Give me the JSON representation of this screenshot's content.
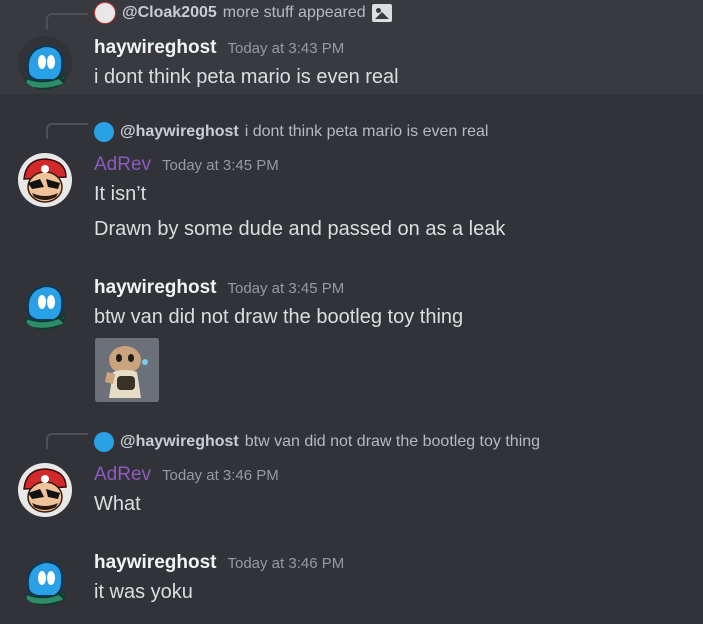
{
  "messages": [
    {
      "reply": {
        "mention": "@Cloak2005",
        "text": "more stuff appeared",
        "icon": "image-icon"
      },
      "author": "haywireghost",
      "timestamp": "Today at 3:43 PM",
      "lines": [
        "i dont think peta mario is even real"
      ]
    },
    {
      "reply": {
        "mention": "@haywireghost",
        "text": "i dont think peta mario is even real"
      },
      "author": "AdRev",
      "timestamp": "Today at 3:45 PM",
      "lines": [
        "It isn’t",
        "Drawn by some dude and passed on as a leak"
      ]
    },
    {
      "author": "haywireghost",
      "timestamp": "Today at 3:45 PM",
      "lines": [
        "btw van did not draw the bootleg toy thing"
      ],
      "attachment": "cat-image"
    },
    {
      "reply": {
        "mention": "@haywireghost",
        "text": "btw van did not draw the bootleg toy thing"
      },
      "author": "AdRev",
      "timestamp": "Today at 3:46 PM",
      "lines": [
        "What"
      ]
    },
    {
      "author": "haywireghost",
      "timestamp": "Today at 3:46 PM",
      "lines": [
        "it was yoku"
      ]
    }
  ],
  "colors": {
    "background": "#313338",
    "highlight": "#383a40",
    "adrev_name": "#8e5bbf",
    "text": "#dbdee1",
    "muted": "#949ba4"
  }
}
